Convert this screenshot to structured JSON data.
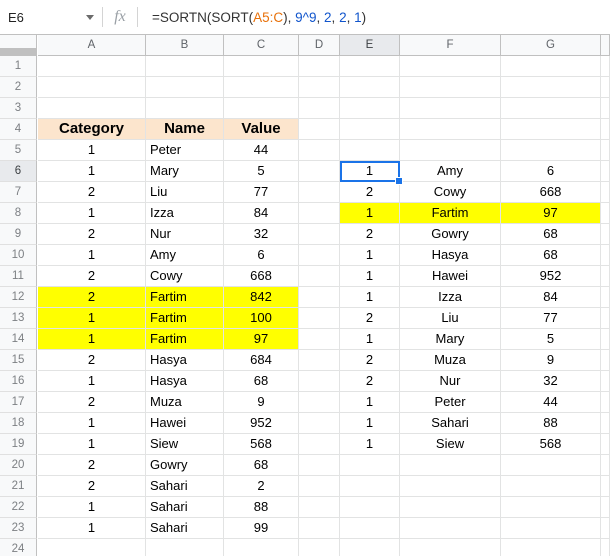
{
  "formula_bar": {
    "name_box_value": "E6",
    "name_box_caret_icon": "chevron-down-icon",
    "fx_icon": "fx-icon",
    "formula_parts": {
      "p1": "=SORTN(SORT(",
      "ref": "A5:C",
      "p2": "), ",
      "n1": "9^9",
      "p3": ", ",
      "n2": "2",
      "p4": ", ",
      "n3": "2",
      "p5": ", ",
      "n4": "1",
      "p6": ")"
    },
    "formula_full": "=SORTN(SORT(A5:C), 9^9, 2, 2, 1)"
  },
  "grid": {
    "column_headers": [
      "A",
      "B",
      "C",
      "D",
      "E",
      "F",
      "G"
    ],
    "active_column": "E",
    "row_headers": [
      "1",
      "2",
      "3",
      "4",
      "5",
      "6",
      "7",
      "8",
      "9",
      "10",
      "11",
      "12",
      "13",
      "14",
      "15",
      "16",
      "17",
      "18",
      "19",
      "20",
      "21",
      "22",
      "23",
      "24"
    ],
    "active_row": "6",
    "selected_cell": "E6"
  },
  "source_table": {
    "header": {
      "category": "Category",
      "name": "Name",
      "value": "Value"
    },
    "header_row": "4",
    "header_bg": "#fce5cd",
    "highlight_color": "#ffff00",
    "rows": [
      {
        "row": "5",
        "category": "1",
        "name": "Peter",
        "value": "44",
        "highlight": false
      },
      {
        "row": "6",
        "category": "1",
        "name": "Mary",
        "value": "5",
        "highlight": false
      },
      {
        "row": "7",
        "category": "2",
        "name": "Liu",
        "value": "77",
        "highlight": false
      },
      {
        "row": "8",
        "category": "1",
        "name": "Izza",
        "value": "84",
        "highlight": false
      },
      {
        "row": "9",
        "category": "2",
        "name": "Nur",
        "value": "32",
        "highlight": false
      },
      {
        "row": "10",
        "category": "1",
        "name": "Amy",
        "value": "6",
        "highlight": false
      },
      {
        "row": "11",
        "category": "2",
        "name": "Cowy",
        "value": "668",
        "highlight": false
      },
      {
        "row": "12",
        "category": "2",
        "name": "Fartim",
        "value": "842",
        "highlight": true
      },
      {
        "row": "13",
        "category": "1",
        "name": "Fartim",
        "value": "100",
        "highlight": true
      },
      {
        "row": "14",
        "category": "1",
        "name": "Fartim",
        "value": "97",
        "highlight": true
      },
      {
        "row": "15",
        "category": "2",
        "name": "Hasya",
        "value": "684",
        "highlight": false
      },
      {
        "row": "16",
        "category": "1",
        "name": "Hasya",
        "value": "68",
        "highlight": false
      },
      {
        "row": "17",
        "category": "2",
        "name": "Muza",
        "value": "9",
        "highlight": false
      },
      {
        "row": "18",
        "category": "1",
        "name": "Hawei",
        "value": "952",
        "highlight": false
      },
      {
        "row": "19",
        "category": "1",
        "name": "Siew",
        "value": "568",
        "highlight": false
      },
      {
        "row": "20",
        "category": "2",
        "name": "Gowry",
        "value": "68",
        "highlight": false
      },
      {
        "row": "21",
        "category": "2",
        "name": "Sahari",
        "value": "2",
        "highlight": false
      },
      {
        "row": "22",
        "category": "1",
        "name": "Sahari",
        "value": "88",
        "highlight": false
      },
      {
        "row": "23",
        "category": "1",
        "name": "Sahari",
        "value": "99",
        "highlight": false
      }
    ]
  },
  "result_table": {
    "start_row": "6",
    "highlight_color": "#ffff00",
    "rows": [
      {
        "row": "6",
        "category": "1",
        "name": "Amy",
        "value": "6",
        "highlight": false
      },
      {
        "row": "7",
        "category": "2",
        "name": "Cowy",
        "value": "668",
        "highlight": false
      },
      {
        "row": "8",
        "category": "1",
        "name": "Fartim",
        "value": "97",
        "highlight": true
      },
      {
        "row": "9",
        "category": "2",
        "name": "Gowry",
        "value": "68",
        "highlight": false
      },
      {
        "row": "10",
        "category": "1",
        "name": "Hasya",
        "value": "68",
        "highlight": false
      },
      {
        "row": "11",
        "category": "1",
        "name": "Hawei",
        "value": "952",
        "highlight": false
      },
      {
        "row": "12",
        "category": "1",
        "name": "Izza",
        "value": "84",
        "highlight": false
      },
      {
        "row": "13",
        "category": "2",
        "name": "Liu",
        "value": "77",
        "highlight": false
      },
      {
        "row": "14",
        "category": "1",
        "name": "Mary",
        "value": "5",
        "highlight": false
      },
      {
        "row": "15",
        "category": "2",
        "name": "Muza",
        "value": "9",
        "highlight": false
      },
      {
        "row": "16",
        "category": "2",
        "name": "Nur",
        "value": "32",
        "highlight": false
      },
      {
        "row": "17",
        "category": "1",
        "name": "Peter",
        "value": "44",
        "highlight": false
      },
      {
        "row": "18",
        "category": "1",
        "name": "Sahari",
        "value": "88",
        "highlight": false
      },
      {
        "row": "19",
        "category": "1",
        "name": "Siew",
        "value": "568",
        "highlight": false
      }
    ]
  }
}
